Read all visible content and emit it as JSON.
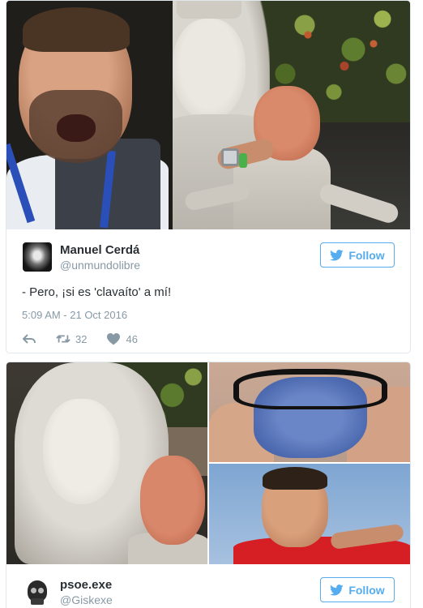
{
  "tweets": [
    {
      "display_name": "Manuel Cerdá",
      "handle": "@unmundolibre",
      "follow_label": "Follow",
      "text": "- Pero, ¡si es 'clavaíto' a mí!",
      "timestamp": "5:09 AM - 21 Oct 2016",
      "retweets": "32",
      "likes": "46"
    },
    {
      "display_name": "psoe.exe",
      "handle": "@Giskexe",
      "follow_label": "Follow"
    }
  ],
  "colors": {
    "accent": "#55acee",
    "text": "#292f33",
    "muted": "#8899a6",
    "border": "#e1e8ed"
  },
  "icons": {
    "follow": "twitter-bird-icon",
    "reply": "reply-icon",
    "retweet": "retweet-icon",
    "like": "heart-icon"
  }
}
